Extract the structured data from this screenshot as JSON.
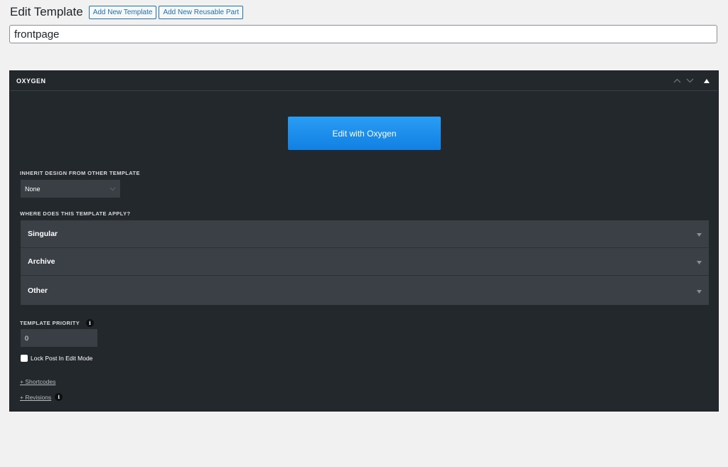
{
  "header": {
    "title": "Edit Template",
    "add_template_label": "Add New Template",
    "add_reusable_label": "Add New Reusable Part"
  },
  "post_title": {
    "value": "frontpage"
  },
  "metabox": {
    "title": "OXYGEN",
    "edit_button_label": "Edit with Oxygen",
    "inherit_label": "INHERIT DESIGN FROM OTHER TEMPLATE",
    "inherit_value": "None",
    "apply_label": "WHERE DOES THIS TEMPLATE APPLY?",
    "apply_sections": [
      "Singular",
      "Archive",
      "Other"
    ],
    "priority_label": "TEMPLATE PRIORITY",
    "priority_value": "0",
    "info_glyph": "i",
    "lock_label": "Lock Post In Edit Mode",
    "shortcodes_link": "+ Shortcodes",
    "revisions_link": "+ Revisions"
  },
  "colors": {
    "accent": "#2271b1",
    "metabox_bg": "#23282d",
    "button_blue": "#1a8ceb"
  },
  "icons": {
    "move_up": "chevron-up-icon",
    "move_down": "chevron-down-icon",
    "toggle": "triangle-up-icon",
    "dropdown": "caret-down-icon",
    "info": "info-icon"
  }
}
